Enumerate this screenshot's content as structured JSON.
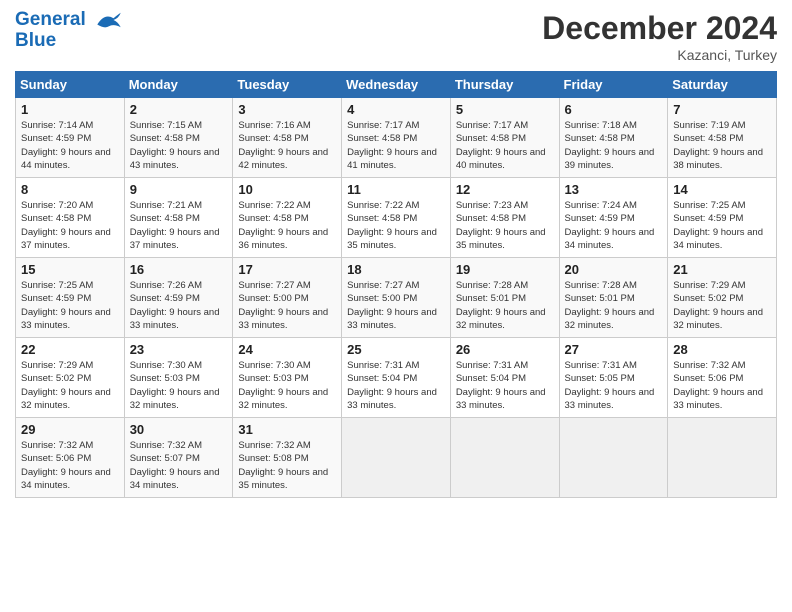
{
  "header": {
    "logo_line1": "General",
    "logo_line2": "Blue",
    "month": "December 2024",
    "location": "Kazanci, Turkey"
  },
  "weekdays": [
    "Sunday",
    "Monday",
    "Tuesday",
    "Wednesday",
    "Thursday",
    "Friday",
    "Saturday"
  ],
  "weeks": [
    [
      {
        "day": "1",
        "sunrise": "7:14 AM",
        "sunset": "4:59 PM",
        "daylight": "9 hours and 44 minutes."
      },
      {
        "day": "2",
        "sunrise": "7:15 AM",
        "sunset": "4:58 PM",
        "daylight": "9 hours and 43 minutes."
      },
      {
        "day": "3",
        "sunrise": "7:16 AM",
        "sunset": "4:58 PM",
        "daylight": "9 hours and 42 minutes."
      },
      {
        "day": "4",
        "sunrise": "7:17 AM",
        "sunset": "4:58 PM",
        "daylight": "9 hours and 41 minutes."
      },
      {
        "day": "5",
        "sunrise": "7:17 AM",
        "sunset": "4:58 PM",
        "daylight": "9 hours and 40 minutes."
      },
      {
        "day": "6",
        "sunrise": "7:18 AM",
        "sunset": "4:58 PM",
        "daylight": "9 hours and 39 minutes."
      },
      {
        "day": "7",
        "sunrise": "7:19 AM",
        "sunset": "4:58 PM",
        "daylight": "9 hours and 38 minutes."
      }
    ],
    [
      {
        "day": "8",
        "sunrise": "7:20 AM",
        "sunset": "4:58 PM",
        "daylight": "9 hours and 37 minutes."
      },
      {
        "day": "9",
        "sunrise": "7:21 AM",
        "sunset": "4:58 PM",
        "daylight": "9 hours and 37 minutes."
      },
      {
        "day": "10",
        "sunrise": "7:22 AM",
        "sunset": "4:58 PM",
        "daylight": "9 hours and 36 minutes."
      },
      {
        "day": "11",
        "sunrise": "7:22 AM",
        "sunset": "4:58 PM",
        "daylight": "9 hours and 35 minutes."
      },
      {
        "day": "12",
        "sunrise": "7:23 AM",
        "sunset": "4:58 PM",
        "daylight": "9 hours and 35 minutes."
      },
      {
        "day": "13",
        "sunrise": "7:24 AM",
        "sunset": "4:59 PM",
        "daylight": "9 hours and 34 minutes."
      },
      {
        "day": "14",
        "sunrise": "7:25 AM",
        "sunset": "4:59 PM",
        "daylight": "9 hours and 34 minutes."
      }
    ],
    [
      {
        "day": "15",
        "sunrise": "7:25 AM",
        "sunset": "4:59 PM",
        "daylight": "9 hours and 33 minutes."
      },
      {
        "day": "16",
        "sunrise": "7:26 AM",
        "sunset": "4:59 PM",
        "daylight": "9 hours and 33 minutes."
      },
      {
        "day": "17",
        "sunrise": "7:27 AM",
        "sunset": "5:00 PM",
        "daylight": "9 hours and 33 minutes."
      },
      {
        "day": "18",
        "sunrise": "7:27 AM",
        "sunset": "5:00 PM",
        "daylight": "9 hours and 33 minutes."
      },
      {
        "day": "19",
        "sunrise": "7:28 AM",
        "sunset": "5:01 PM",
        "daylight": "9 hours and 32 minutes."
      },
      {
        "day": "20",
        "sunrise": "7:28 AM",
        "sunset": "5:01 PM",
        "daylight": "9 hours and 32 minutes."
      },
      {
        "day": "21",
        "sunrise": "7:29 AM",
        "sunset": "5:02 PM",
        "daylight": "9 hours and 32 minutes."
      }
    ],
    [
      {
        "day": "22",
        "sunrise": "7:29 AM",
        "sunset": "5:02 PM",
        "daylight": "9 hours and 32 minutes."
      },
      {
        "day": "23",
        "sunrise": "7:30 AM",
        "sunset": "5:03 PM",
        "daylight": "9 hours and 32 minutes."
      },
      {
        "day": "24",
        "sunrise": "7:30 AM",
        "sunset": "5:03 PM",
        "daylight": "9 hours and 32 minutes."
      },
      {
        "day": "25",
        "sunrise": "7:31 AM",
        "sunset": "5:04 PM",
        "daylight": "9 hours and 33 minutes."
      },
      {
        "day": "26",
        "sunrise": "7:31 AM",
        "sunset": "5:04 PM",
        "daylight": "9 hours and 33 minutes."
      },
      {
        "day": "27",
        "sunrise": "7:31 AM",
        "sunset": "5:05 PM",
        "daylight": "9 hours and 33 minutes."
      },
      {
        "day": "28",
        "sunrise": "7:32 AM",
        "sunset": "5:06 PM",
        "daylight": "9 hours and 33 minutes."
      }
    ],
    [
      {
        "day": "29",
        "sunrise": "7:32 AM",
        "sunset": "5:06 PM",
        "daylight": "9 hours and 34 minutes."
      },
      {
        "day": "30",
        "sunrise": "7:32 AM",
        "sunset": "5:07 PM",
        "daylight": "9 hours and 34 minutes."
      },
      {
        "day": "31",
        "sunrise": "7:32 AM",
        "sunset": "5:08 PM",
        "daylight": "9 hours and 35 minutes."
      },
      null,
      null,
      null,
      null
    ]
  ]
}
